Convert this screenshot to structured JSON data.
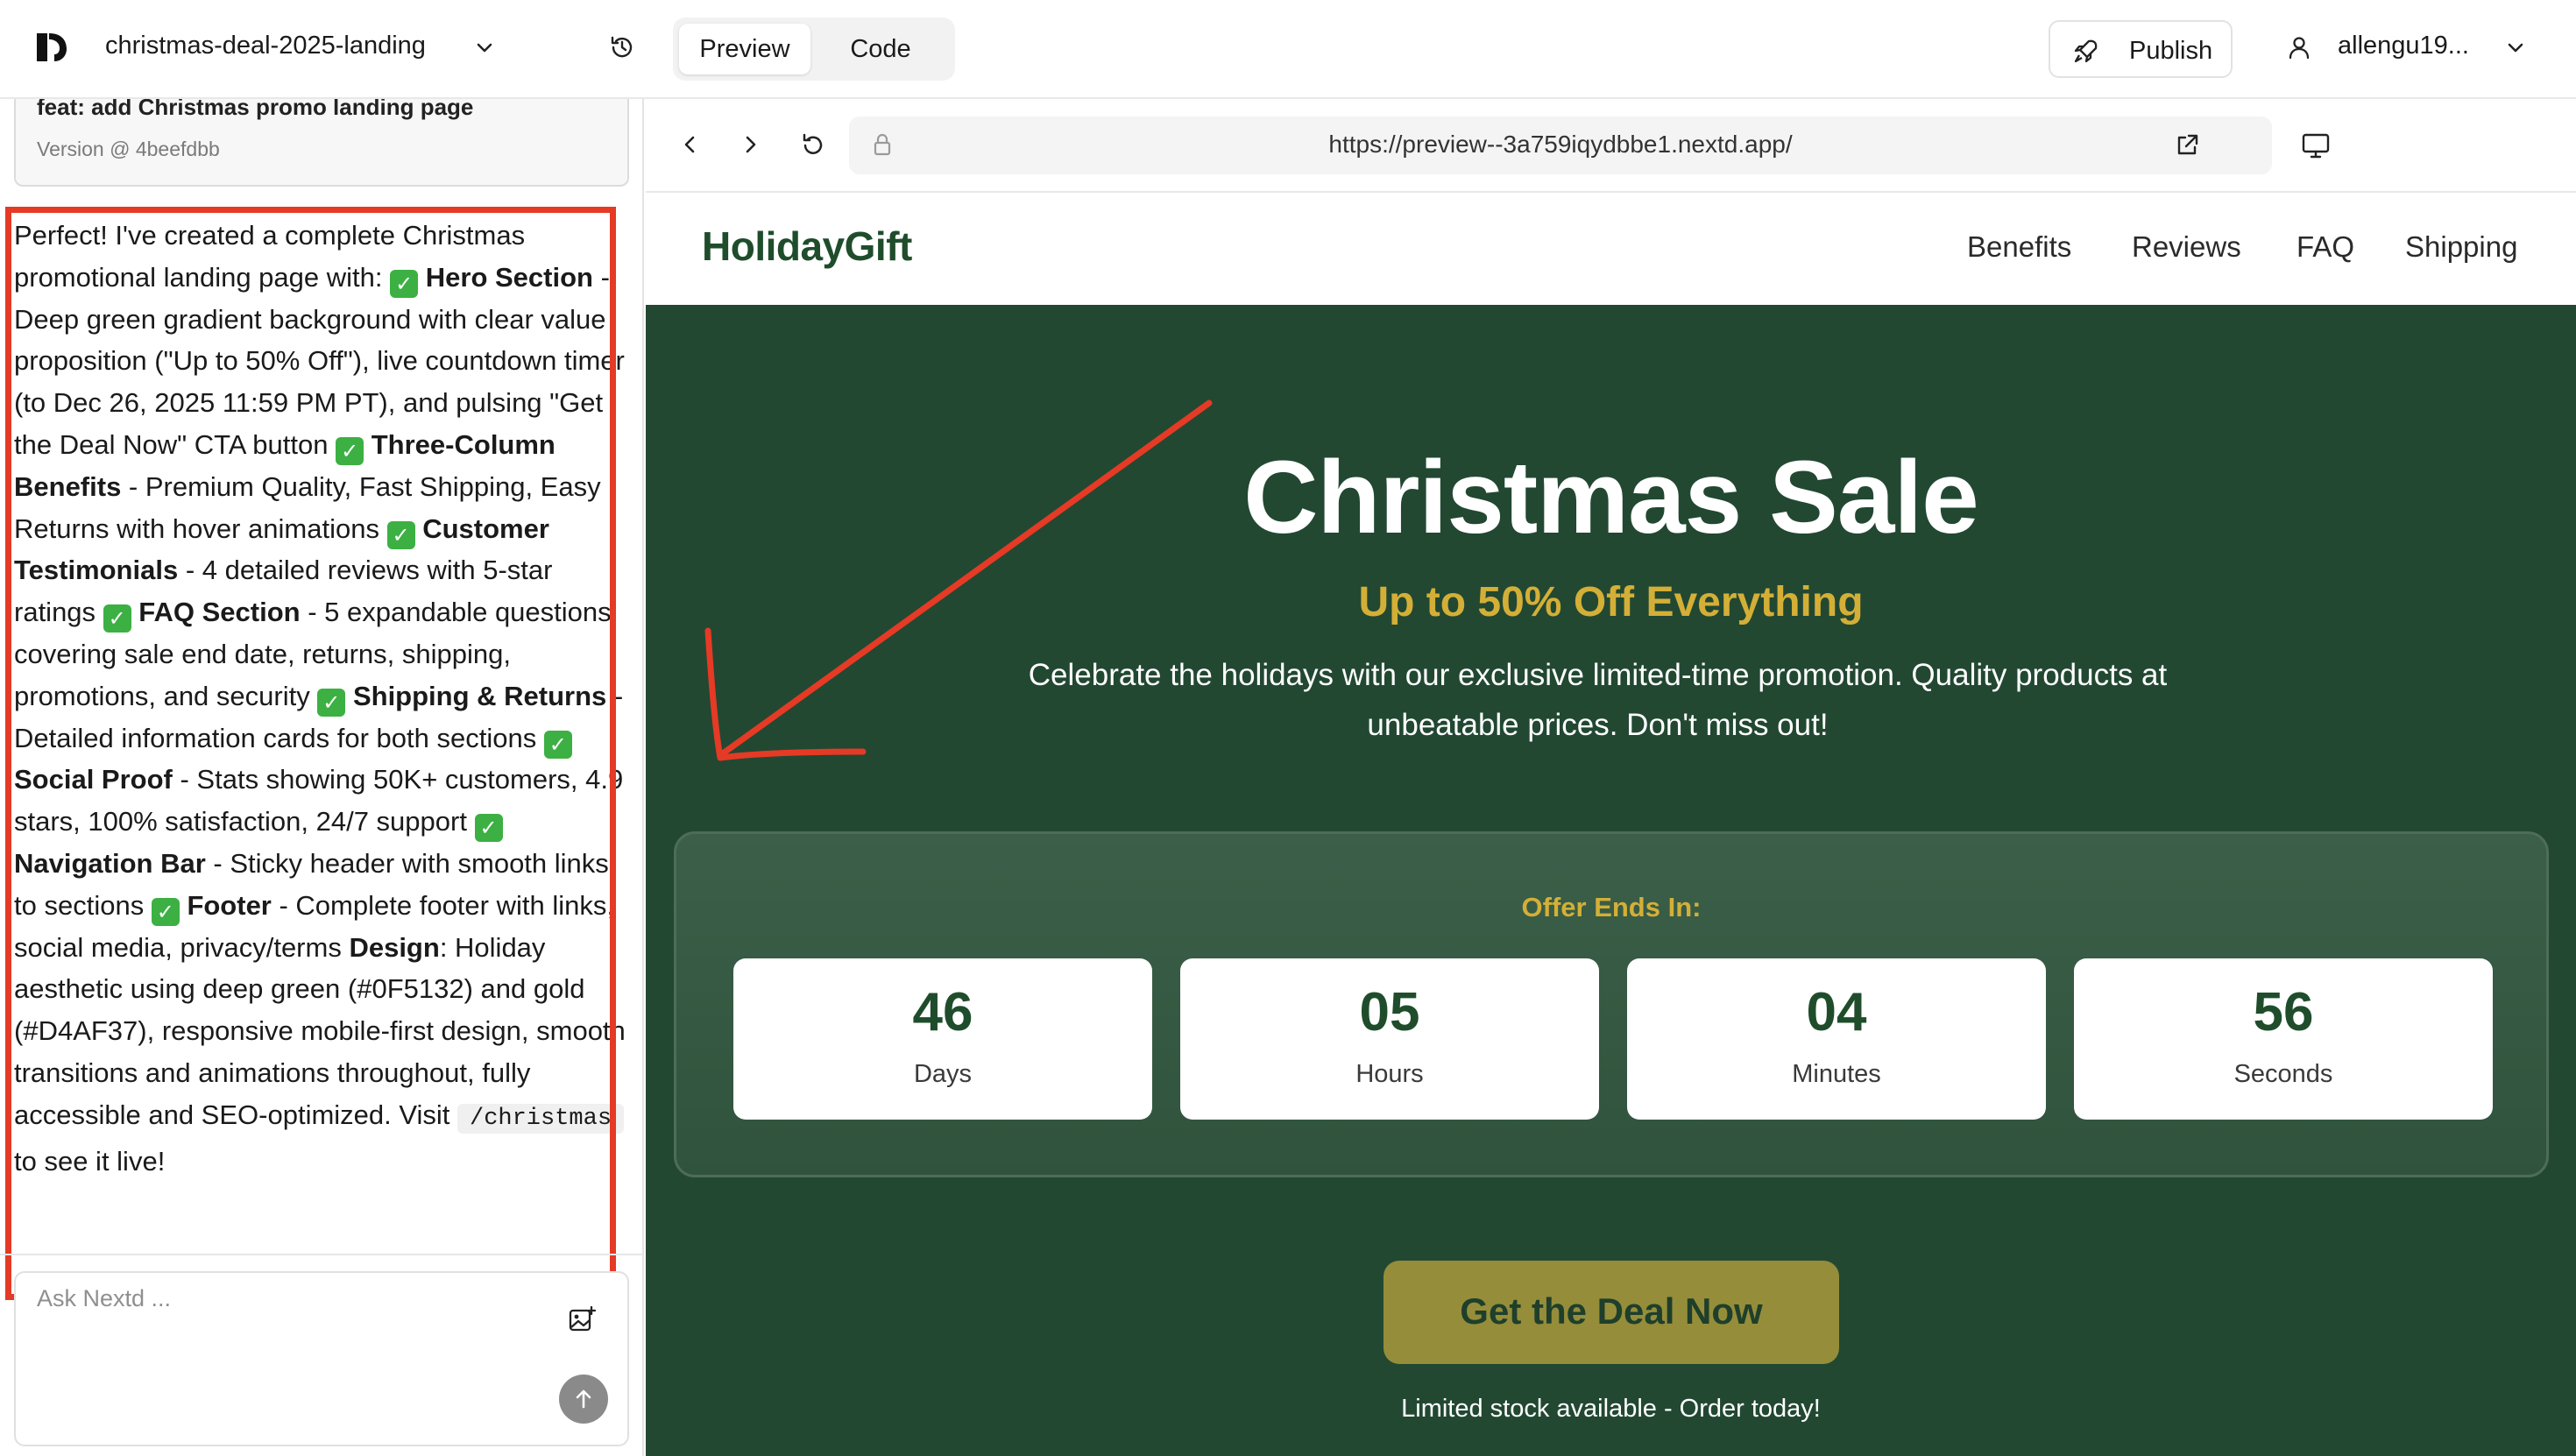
{
  "topbar": {
    "project_name": "christmas-deal-2025-landing",
    "tabs": {
      "preview": "Preview",
      "code": "Code"
    },
    "publish_label": "Publish",
    "user_name": "allengu19..."
  },
  "version": {
    "title": "feat: add Christmas promo landing page",
    "label": "Version @ 4beefdbb"
  },
  "chat": {
    "m01": "Perfect! I've created a complete Christmas promotional landing page with: ",
    "b01": "Hero Section",
    "m02": " - Deep green gradient background with clear value proposition (\"Up to 50% Off\"), live countdown timer (to Dec 26, 2025 11:59 PM PT), and pulsing \"Get the Deal Now\" CTA button ",
    "b02": "Three-Column Benefits",
    "m03": " - Premium Quality, Fast Shipping, Easy Returns with hover animations ",
    "b03": "Customer Testimonials",
    "m04": " - 4 detailed reviews with 5-star ratings ",
    "b04": "FAQ Section",
    "m05": " - 5 expandable questions covering sale end date, returns, shipping, promotions, and security ",
    "b05": "Shipping & Returns",
    "m06": " - Detailed information cards for both sections ",
    "b06": "Social Proof",
    "m07": " - Stats showing 50K+ customers, 4.9 stars, 100% satisfaction, 24/7 support ",
    "b07": "Navigation Bar",
    "m08": " - Sticky header with smooth links to sections ",
    "b08": "Footer",
    "m09": " - Complete footer with links, social media, privacy/terms ",
    "b09": "Design",
    "m10": ": Holiday aesthetic using deep green (#0F5132) and gold (#D4AF37), responsive mobile-first design, smooth transitions and animations throughout, fully accessible and SEO-optimized. Visit ",
    "code": "/christmas",
    "m11": " to see it live!",
    "input_placeholder": "Ask Nextd ..."
  },
  "browser": {
    "url": "https://preview--3a759iqydbbe1.nextd.app/"
  },
  "site": {
    "brand": "HolidayGift",
    "nav": [
      "Benefits",
      "Reviews",
      "FAQ",
      "Shipping"
    ],
    "hero": {
      "title": "Christmas Sale",
      "subtitle": "Up to 50% Off Everything",
      "description": "Celebrate the holidays with our exclusive limited-time promotion. Quality products at unbeatable prices. Don't miss out!",
      "countdown_label": "Offer Ends In:",
      "countdown": [
        {
          "value": "46",
          "unit": "Days"
        },
        {
          "value": "05",
          "unit": "Hours"
        },
        {
          "value": "04",
          "unit": "Minutes"
        },
        {
          "value": "56",
          "unit": "Seconds"
        }
      ],
      "cta_label": "Get the Deal Now",
      "stock_note": "Limited stock available - Order today!"
    }
  },
  "colors": {
    "brand_green": "#1f4d2c",
    "hero_bg": "#224832",
    "gold": "#d4af37",
    "cta_bg": "#958d3a",
    "annotation_red": "#e53a25"
  },
  "icons": [
    "app-logo-icon",
    "chevron-down-icon",
    "history-icon",
    "rocket-icon",
    "user-icon",
    "arrow-left-icon",
    "arrow-right-icon",
    "reload-icon",
    "lock-icon",
    "external-link-icon",
    "desktop-icon",
    "image-upload-icon",
    "arrow-up-icon",
    "check-icon"
  ]
}
